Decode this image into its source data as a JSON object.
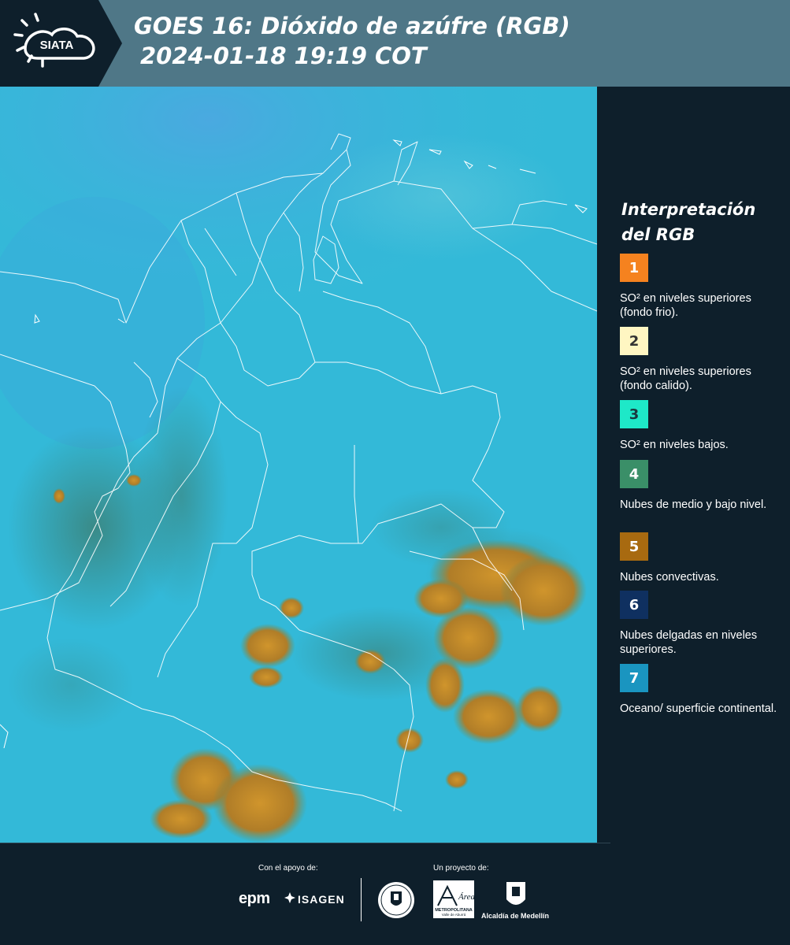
{
  "header": {
    "logo_text": "SIATA",
    "title_line1": "GOES 16: Dióxido de azúfre (RGB)",
    "title_line2": "2024-01-18 19:19 COT",
    "header_color": "#4f7787",
    "panel_color": "#0e1f2b"
  },
  "legend": {
    "title_line1": "Interpretación",
    "title_line2": "del RGB",
    "items": [
      {
        "number": "1",
        "label": "SO² en niveles superiores (fondo frio).",
        "color": "#f5821f",
        "text_color": "#ffffff"
      },
      {
        "number": "2",
        "label": "SO² en niveles superiores (fondo calido).",
        "color": "#fff6c2",
        "text_color": "#333333"
      },
      {
        "number": "3",
        "label": "SO² en niveles bajos.",
        "color": "#1ee8c8",
        "text_color": "#1a3a40"
      },
      {
        "number": "4",
        "label": "Nubes de medio y bajo nivel.",
        "color": "#3a8f68",
        "text_color": "#ffffff"
      },
      {
        "number": "5",
        "label": "Nubes convectivas.",
        "color": "#a86a10",
        "text_color": "#ffffff"
      },
      {
        "number": "6",
        "label": "Nubes delgadas en niveles superiores.",
        "color": "#0f3060",
        "text_color": "#ffffff"
      },
      {
        "number": "7",
        "label": "Oceano/ superficie continental.",
        "color": "#1a95c0",
        "text_color": "#ffffff"
      }
    ]
  },
  "map": {
    "ocean_color": "#35b9d6",
    "convective_color": "#b8862a",
    "low_cloud_color": "#3f8f7a",
    "border_color": "#ffffff"
  },
  "footer": {
    "support_label": "Con el apoyo de:",
    "project_label": "Un proyecto de:",
    "sponsor1": "epm",
    "sponsor2": "ISAGEN",
    "partner1": "Área",
    "partner1_sub": "METROPOLITANA",
    "partner1_sub2": "Valle de Aburrá",
    "partner2": "Alcaldía de Medellín"
  }
}
